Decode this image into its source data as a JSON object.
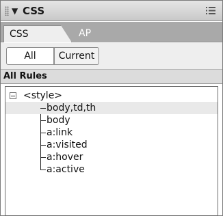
{
  "panel": {
    "title": "CSS",
    "collapse_glyph": "▼",
    "options_icon": "options-menu-icon"
  },
  "tabs": [
    {
      "label": "CSS Styles",
      "active": true
    },
    {
      "label": "AP Elements",
      "active": false
    }
  ],
  "filter": {
    "all_label": "All",
    "current_label": "Current",
    "selected": "All"
  },
  "rules": {
    "header": "All Rules",
    "root_label": "<style>",
    "items": [
      {
        "label": "body,td,th",
        "selected": true
      },
      {
        "label": "body",
        "selected": false
      },
      {
        "label": "a:link",
        "selected": false
      },
      {
        "label": "a:visited",
        "selected": false
      },
      {
        "label": "a:hover",
        "selected": false
      },
      {
        "label": "a:active",
        "selected": false
      }
    ]
  }
}
